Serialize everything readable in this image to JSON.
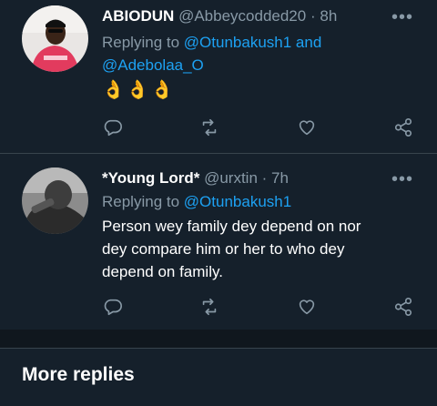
{
  "tweets": [
    {
      "name": "ABIODUN",
      "handle": "@Abbeycodded20",
      "sep": "·",
      "time": "8h",
      "replying_prefix": "Replying to",
      "replying_to": [
        "@Otunbakush1",
        "@Adebolaa_O"
      ],
      "replying_joiner": "and",
      "text": "👌👌👌",
      "avatar_icon": "profile-photo-red-jersey"
    },
    {
      "name": "*Young Lord*",
      "handle": "@urxtin",
      "sep": "·",
      "time": "7h",
      "replying_prefix": "Replying to",
      "replying_to": [
        "@Otunbakush1"
      ],
      "text_lines": [
        "Person wey family dey depend on nor",
        "dey compare him or her to who dey",
        "depend on family."
      ],
      "avatar_icon": "profile-photo-bw"
    }
  ],
  "more_glyph": "•••",
  "action_icons": [
    "reply-icon",
    "retweet-icon",
    "like-icon",
    "share-icon"
  ],
  "more_replies_label": "More replies",
  "colors": {
    "background": "#15202b",
    "secondary_text": "#8899a6",
    "link": "#1da1f2",
    "divider": "#38444d",
    "band": "#10171e"
  }
}
